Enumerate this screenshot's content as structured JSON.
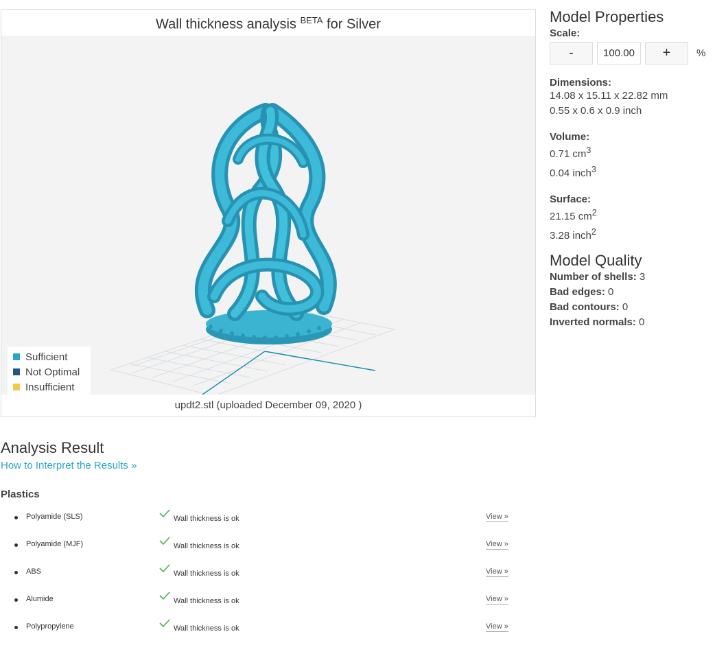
{
  "viewer": {
    "title_prefix": "Wall thickness analysis",
    "title_beta": "BETA",
    "title_suffix": "for Silver",
    "caption": "updt2.stl (uploaded December 09, 2020 )",
    "legend": [
      {
        "label": "Sufficient",
        "color": "#2aa5c9"
      },
      {
        "label": "Not Optimal",
        "color": "#1c5a80"
      },
      {
        "label": "Insufficient",
        "color": "#f2c94c"
      }
    ],
    "model_color": "#2fa6c4"
  },
  "properties": {
    "title": "Model Properties",
    "scale_label": "Scale:",
    "minus": "-",
    "scale_value": "100.00",
    "plus": "+",
    "percent": "%",
    "dimensions_label": "Dimensions:",
    "dimensions_mm": "14.08 x 15.11 x 22.82 mm",
    "dimensions_inch": "0.55 x 0.6 x 0.9 inch",
    "volume_label": "Volume:",
    "volume_cm": "0.71 cm",
    "volume_inch": "0.04 inch",
    "volume_exp": "3",
    "surface_label": "Surface:",
    "surface_cm": "21.15 cm",
    "surface_inch": "3.28 inch",
    "surface_exp": "2"
  },
  "quality": {
    "title": "Model Quality",
    "rows": [
      {
        "label": "Number of shells:",
        "value": "3"
      },
      {
        "label": "Bad edges:",
        "value": "0"
      },
      {
        "label": "Bad contours:",
        "value": "0"
      },
      {
        "label": "Inverted normals:",
        "value": "0"
      }
    ]
  },
  "analysis": {
    "title": "Analysis Result",
    "link": "How to Interpret the Results »",
    "category": "Plastics",
    "materials": [
      {
        "name": "Polyamide (SLS)",
        "status": "Wall thickness is ok",
        "view": "View »"
      },
      {
        "name": "Polyamide (MJF)",
        "status": "Wall thickness is ok",
        "view": "View »"
      },
      {
        "name": "ABS",
        "status": "Wall thickness is ok",
        "view": "View »"
      },
      {
        "name": "Alumide",
        "status": "Wall thickness is ok",
        "view": "View »"
      },
      {
        "name": "Polypropylene",
        "status": "Wall thickness is ok",
        "view": "View »"
      }
    ],
    "check_color": "#4caf50"
  }
}
